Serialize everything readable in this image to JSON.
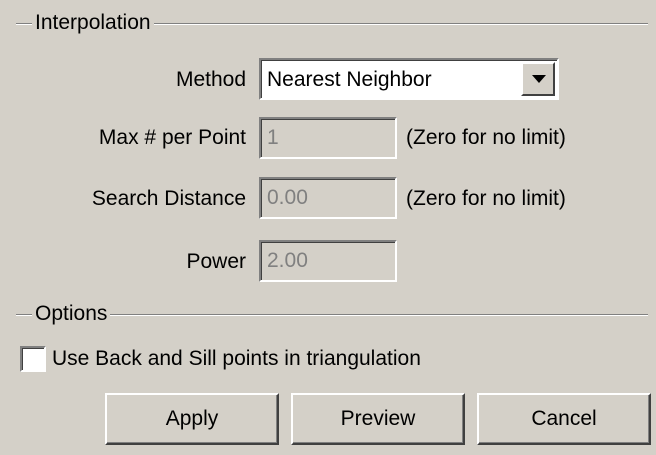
{
  "interpolation": {
    "title": "Interpolation",
    "method": {
      "label": "Method",
      "selected": "Nearest Neighbor"
    },
    "max_per_point": {
      "label": "Max # per Point",
      "value": "1",
      "hint": "(Zero for no limit)"
    },
    "search_distance": {
      "label": "Search Distance",
      "value": "0.00",
      "hint": "(Zero for no limit)"
    },
    "power": {
      "label": "Power",
      "value": "2.00"
    }
  },
  "options": {
    "title": "Options",
    "use_back_sill": {
      "label": "Use Back and Sill points in triangulation",
      "checked": false
    }
  },
  "buttons": {
    "apply": "Apply",
    "preview": "Preview",
    "cancel": "Cancel"
  },
  "colors": {
    "background": "#d4d0c8",
    "disabled_text": "#808080"
  }
}
